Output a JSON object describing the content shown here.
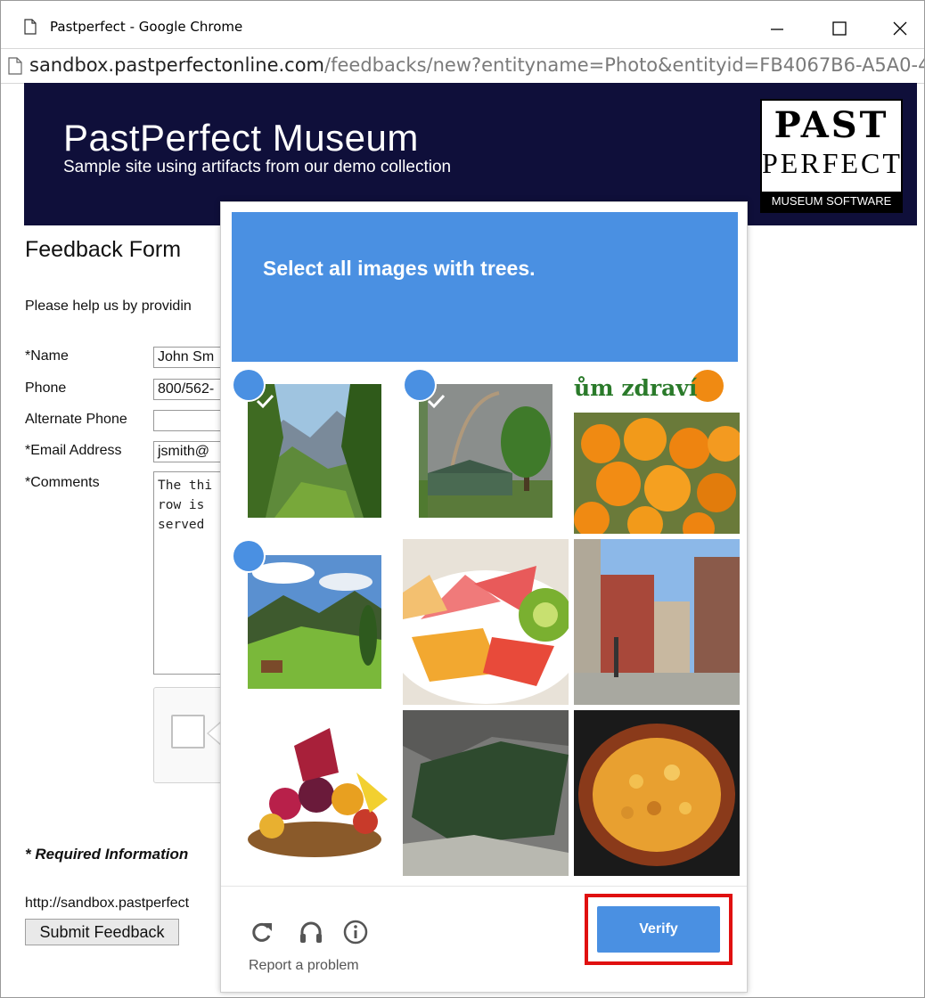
{
  "window": {
    "title": "Pastperfect - Google Chrome",
    "url_host": "sandbox.pastperfectonline.com",
    "url_path": "/feedbacks/new?entityname=Photo&entityid=FB4067B6-A5A0-4"
  },
  "banner": {
    "title": "PastPerfect Museum",
    "subtitle": "Sample site using artifacts from our demo collection",
    "logo_line1": "PAST",
    "logo_line2": "PERFECT",
    "logo_line3": "MUSEUM SOFTWARE"
  },
  "form": {
    "title": "Feedback Form",
    "intro": "Please help us by providin",
    "fields": [
      {
        "label": "*Name",
        "value": "John Sm"
      },
      {
        "label": "Phone",
        "value": "800/562-"
      },
      {
        "label": "Alternate Phone",
        "value": ""
      },
      {
        "label": "*Email Address",
        "value": "jsmith@"
      },
      {
        "label": "*Comments",
        "value": "The thi\nrow is \nserved "
      }
    ],
    "required_note": "* Required Information",
    "url_text": "http://sandbox.pastperfect",
    "submit_label": "Submit Feedback"
  },
  "captcha": {
    "prompt_text": "Select all images with ",
    "prompt_keyword": "trees.",
    "accent_color": "#4a90e2",
    "tiles": [
      {
        "name": "mountain-valley-trees",
        "selected": true
      },
      {
        "name": "rainbow-barn-tree",
        "selected": true
      },
      {
        "name": "sea-buckthorn-berries",
        "selected": false
      },
      {
        "name": "alpine-meadow-cabin",
        "selected": true
      },
      {
        "name": "fruit-salad-bowl",
        "selected": false
      },
      {
        "name": "city-street-buildings",
        "selected": false
      },
      {
        "name": "fruit-basket",
        "selected": false
      },
      {
        "name": "river-rocks",
        "selected": false
      },
      {
        "name": "stew-casserole",
        "selected": false
      }
    ],
    "berries_caption": "ům zdraví",
    "report_label": "Report a problem",
    "verify_label": "Verify",
    "highlight_color": "#e01010"
  }
}
